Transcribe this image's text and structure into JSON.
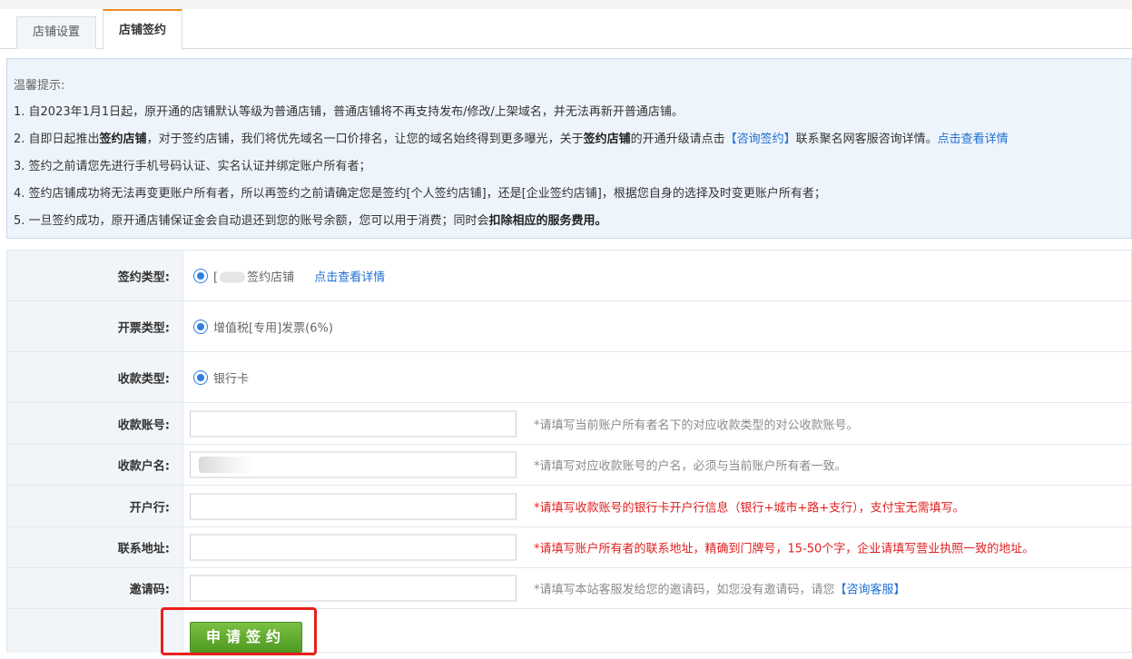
{
  "tabs": [
    {
      "label": "店铺设置"
    },
    {
      "label": "店铺签约"
    }
  ],
  "notice": {
    "title": "温馨提示:",
    "line1": "1. 自2023年1月1日起，原开通的店铺默认等级为普通店铺，普通店铺将不再支持发布/修改/上架域名，并无法再新开普通店铺。",
    "line2_a": "2. 自即日起推出",
    "line2_b": "签约店铺",
    "line2_c": "，对于签约店铺，我们将优先域名一口价排名，让您的域名始终得到更多曝光，关于",
    "line2_d": "签约店铺",
    "line2_e": "的开通升级请点击",
    "line2_link1": "【咨询签约】",
    "line2_f": "联系聚名网客服咨询详情。",
    "line2_link2": "点击查看详情",
    "line3": "3. 签约之前请您先进行手机号码认证、实名认证并绑定账户所有者；",
    "line4": "4. 签约店铺成功将无法再变更账户所有者，所以再签约之前请确定您是签约[个人签约店铺]，还是[企业签约店铺]，根据您自身的选择及时变更账户所有者；",
    "line5_a": "5. 一旦签约成功，原开通店铺保证金会自动退还到您的账号余额，您可以用于消费；同时会",
    "line5_b": "扣除相应的服务费用。"
  },
  "form": {
    "sign_type": {
      "label": "签约类型:",
      "option_prefix": "[",
      "option_suffix": "签约店铺",
      "link": "点击查看详情"
    },
    "invoice_type": {
      "label": "开票类型:",
      "option": "增值税[专用]发票(6%)"
    },
    "payee_type": {
      "label": "收款类型:",
      "option": "银行卡"
    },
    "account_no": {
      "label": "收款账号:",
      "value": "",
      "hint": "*请填写当前账户所有者名下的对应收款类型的对公收款账号。"
    },
    "account_name": {
      "label": "收款户名:",
      "value": "",
      "hint": "*请填写对应收款账号的户名，必须与当前账户所有者一致。"
    },
    "bank": {
      "label": "开户行:",
      "value": "",
      "hint": "*请填写收款账号的银行卡开户行信息（银行+城市+路+支行），支付宝无需填写。"
    },
    "address": {
      "label": "联系地址:",
      "value": "",
      "hint": "*请填写账户所有者的联系地址，精确到门牌号，15-50个字，企业请填写营业执照一致的地址。"
    },
    "invite": {
      "label": "邀请码:",
      "value": "",
      "hint": "*请填写本站客服发给您的邀请码，如您没有邀请码，请您",
      "hint_link": "【咨询客服】"
    },
    "submit_label": "申请签约"
  },
  "colors": {
    "accent": "#f08a24",
    "link": "#1e6fd0",
    "warning": "#e02020",
    "button": "#5aa52c",
    "highlight": "#e8201a"
  }
}
